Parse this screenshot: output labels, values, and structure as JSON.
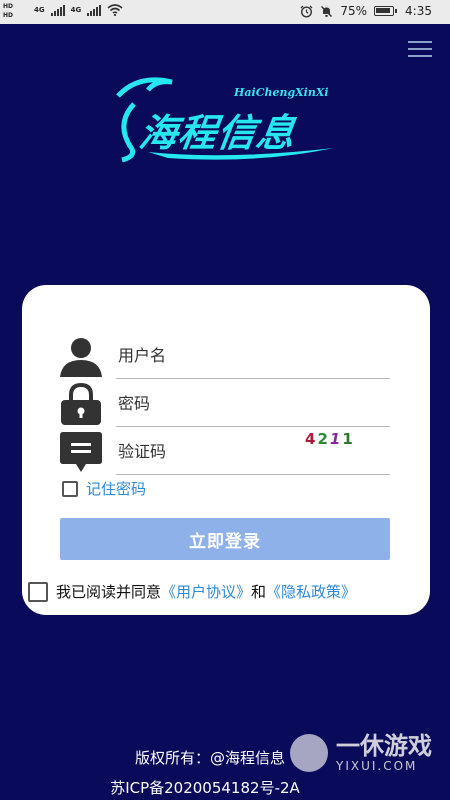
{
  "status_bar": {
    "hd1": "HD",
    "hd2": "HD",
    "net1": "4G",
    "net2": "4G",
    "battery_percent": "75%",
    "time": "4:35"
  },
  "header": {
    "menu_icon": "hamburger-menu-icon"
  },
  "logo": {
    "text_en": "HaiChengXinXi",
    "text_cn": "海程信息"
  },
  "login": {
    "username_placeholder": "用户名",
    "password_placeholder": "密码",
    "captcha_placeholder": "验证码",
    "captcha_digits": [
      "4",
      "2",
      "1",
      "1"
    ],
    "captcha_colors": [
      "#b0183a",
      "#2a8a3a",
      "#8a2aa0",
      "#2a7a2a"
    ],
    "remember_label": "记住密码",
    "remember_checked": false,
    "login_button": "立即登录",
    "agree_checked": false,
    "agree_prefix": "我已阅读并同意",
    "user_agreement": "《用户协议》",
    "and_text": "和",
    "privacy_policy": "《隐私政策》"
  },
  "footer": {
    "copyright": "版权所有：@海程信息",
    "icp": "苏ICP备2020054182号-2A"
  },
  "watermark": {
    "title": "一休游戏",
    "url": "YIXUI.COM"
  },
  "colors": {
    "background": "#0a0a5a",
    "accent": "#2d8ad6",
    "button": "#8fb1ea",
    "logo": "#26e6ef"
  }
}
